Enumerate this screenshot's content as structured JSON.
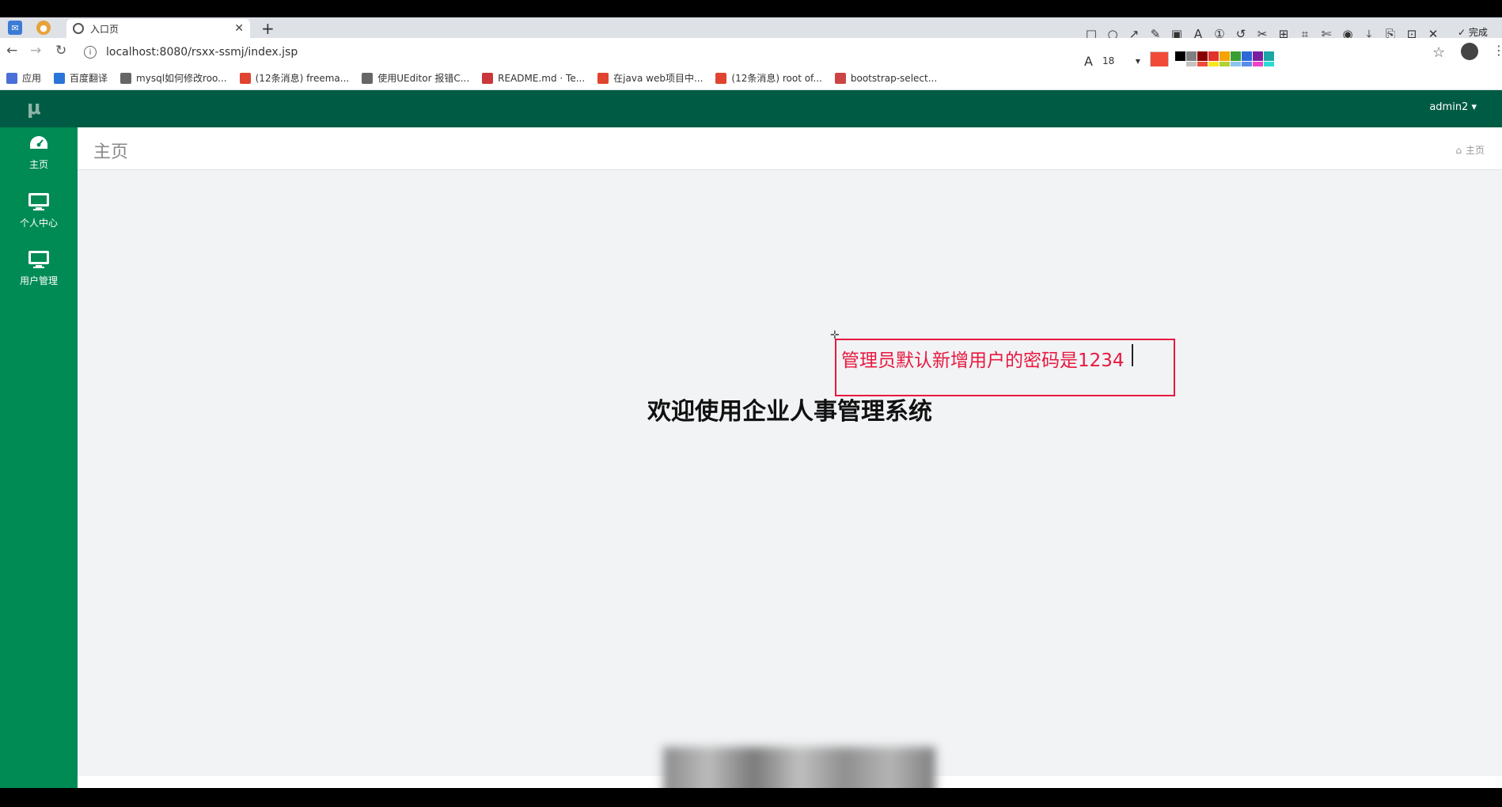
{
  "browser": {
    "tab_title": "入口页",
    "url": "localhost:8080/rsxx-ssmj/index.jsp",
    "bookmarks": [
      {
        "label": "应用",
        "color": "#4a6fd8"
      },
      {
        "label": "百度翻译",
        "color": "#2b74d8"
      },
      {
        "label": "mysql如何修改roo...",
        "color": "#666666"
      },
      {
        "label": "(12条消息) freema...",
        "color": "#e0432f"
      },
      {
        "label": "使用UEditor 报错C...",
        "color": "#666666"
      },
      {
        "label": "README.md · Te...",
        "color": "#c9373a"
      },
      {
        "label": "在java web项目中...",
        "color": "#e0432f"
      },
      {
        "label": "(12条消息) root of...",
        "color": "#e0432f"
      },
      {
        "label": "bootstrap-select...",
        "color": "#cc4444"
      }
    ]
  },
  "annotation_toolbar": {
    "done_label": "完成",
    "font_size": "18",
    "current_color": "#f24a38",
    "palette": [
      "#000000",
      "#7f7f7f",
      "#8b0000",
      "#e0332b",
      "#f4a300",
      "#3a9f32",
      "#2c68d8",
      "#7a1fa0",
      "#1ba6a6",
      "#ffffff",
      "#c3c3c3",
      "#f24a38",
      "#f9e71e",
      "#b0d132",
      "#8cc4f2",
      "#5a8de8",
      "#ee42c7",
      "#2adbd5"
    ]
  },
  "app": {
    "logo": "μ",
    "user": "admin2 ▾",
    "sidebar": [
      {
        "label": "主页"
      },
      {
        "label": "个人中心"
      },
      {
        "label": "用户管理"
      }
    ],
    "page_title": "主页",
    "breadcrumb": "主页",
    "welcome": "欢迎使用企业人事管理系统"
  },
  "annotation": {
    "text": "管理员默认新增用户的密码是1234"
  }
}
